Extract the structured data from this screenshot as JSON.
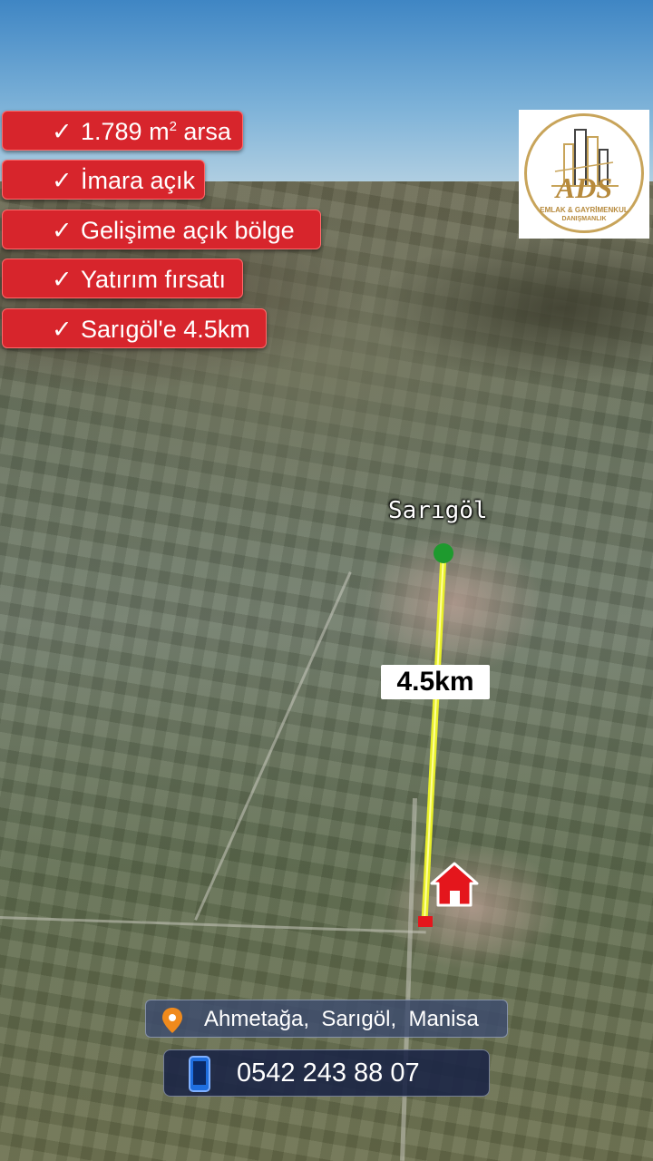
{
  "features": [
    {
      "check": "✓",
      "text": "1.789 m",
      "sup": "2",
      "suffix": " arsa"
    },
    {
      "check": "✓",
      "text": "İmara açık"
    },
    {
      "check": "✓",
      "text": "Gelişime açık bölge"
    },
    {
      "check": "✓",
      "text": "Yatırım fırsatı"
    },
    {
      "check": "✓",
      "text": "Sarıgöl'e 4.5km"
    }
  ],
  "logo": {
    "brand": "ADS",
    "subtitle_line1": "EMLAK & GAYRİMENKUL",
    "subtitle_line2": "DANIŞMANLIK",
    "gold": "#c8a45a",
    "brand_color": "#b78a3c"
  },
  "map": {
    "place_label": "Sarıgöl",
    "distance_label": "4.5km",
    "line_color": "#e8ef2a",
    "start_marker_color": "#1e9a2e",
    "end_marker_color": "#e4161c",
    "home_icon": "home-icon"
  },
  "contact": {
    "address": "Ahmetağa,  Sarıgöl,  Manisa",
    "phone": "0542 243 88 07",
    "pin_color": "#f08a1c"
  }
}
